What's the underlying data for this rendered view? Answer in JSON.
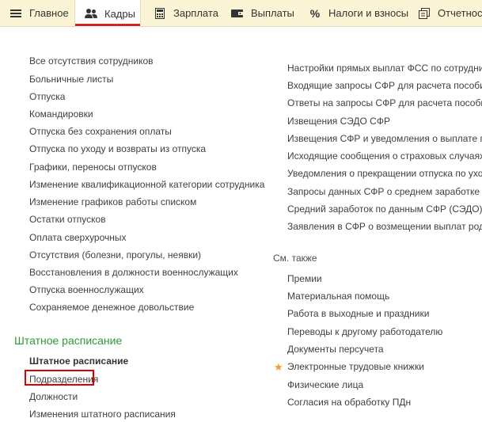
{
  "tabs": [
    {
      "label": "Главное",
      "icon": "menu-icon"
    },
    {
      "label": "Кадры",
      "icon": "people-icon",
      "active": true
    },
    {
      "label": "Зарплата",
      "icon": "calculator-icon"
    },
    {
      "label": "Выплаты",
      "icon": "wallet-icon"
    },
    {
      "label": "Налоги и взносы",
      "icon": "percent-icon"
    },
    {
      "label": "Отчетность",
      "icon": "reports-icon"
    }
  ],
  "left_links": [
    "Все отсутствия сотрудников",
    "Больничные листы",
    "Отпуска",
    "Командировки",
    "Отпуска без сохранения оплаты",
    "Отпуска по уходу и возвраты из отпуска",
    "Графики, переносы отпусков",
    "Изменение квалификационной категории сотрудника",
    "Изменение графиков работы списком",
    "Остатки отпусков",
    "Оплата сверхурочных",
    "Отсутствия (болезни, прогулы, неявки)",
    "Восстановления в должности военнослужащих",
    "Отпуска военнослужащих",
    "Сохраняемое денежное довольствие"
  ],
  "staffing": {
    "title": "Штатное расписание",
    "bold_link": "Штатное расписание",
    "links": [
      "Подразделения",
      "Должности",
      "Изменения штатного расписания"
    ]
  },
  "right_links": [
    "Настройки прямых выплат ФСС по сотрудникам",
    "Входящие запросы СФР для расчета пособий",
    "Ответы на запросы СФР для расчета пособий",
    "Извещения СЭДО СФР",
    "Извещения СФР и уведомления о выплате пос",
    "Исходящие сообщения о страховых случаях С",
    "Уведомления о прекращении отпуска по уходу",
    "Запросы данных СФР о среднем заработке",
    "Средний заработок по данным СФР (СЭДО)",
    "Заявления в СФР о возмещении выплат родите"
  ],
  "see_also": {
    "title": "См. также",
    "links": [
      "Премии",
      "Материальная помощь",
      "Работа в выходные и праздники",
      "Переводы к другому работодателю",
      "Документы персучета",
      "Электронные трудовые книжки",
      "Физические лица",
      "Согласия на обработку ПДн"
    ],
    "starred_index": 5
  },
  "colors": {
    "topbar_bg": "#fbf5d6",
    "active_underline": "#d6231c",
    "section_title": "#2b9a39",
    "highlight_box": "#e00000",
    "star": "#f0a020"
  }
}
